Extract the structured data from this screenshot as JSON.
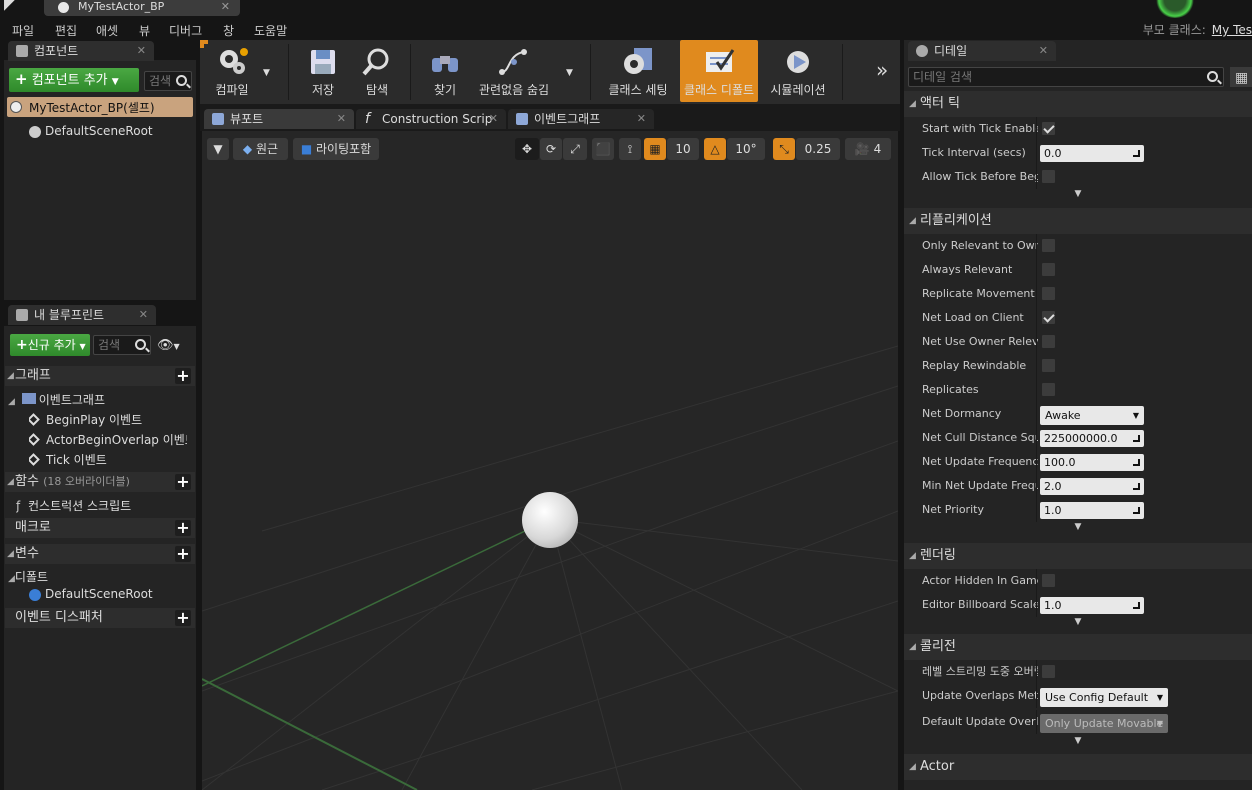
{
  "window": {
    "doc_tab_title": "MyTestActor_BP",
    "parent_class_label": "부모 클래스:",
    "parent_class_value": "My Tes"
  },
  "menu": [
    "파일",
    "편집",
    "애셋",
    "뷰",
    "디버그",
    "창",
    "도움말"
  ],
  "components_panel": {
    "tab_label": "컴포넌트",
    "add_button": "컴포넌트 추가",
    "search_placeholder": "검색",
    "root_item": "MyTestActor_BP(셀프)",
    "child_item": "DefaultSceneRoot"
  },
  "blueprint_panel": {
    "tab_label": "내 블루프린트",
    "add_new_button": "신규 추가",
    "search_placeholder": "검색",
    "sections": {
      "graphs": "그래프",
      "event_graph": "이벤트그래프",
      "events": [
        "BeginPlay 이벤트",
        "ActorBeginOverlap 이벤트",
        "Tick 이벤트"
      ],
      "functions": "함수",
      "functions_note": "(18 오버라이더블)",
      "construction_script": "컨스트럭션 스크립트",
      "macros": "매크로",
      "variables": "변수",
      "components": "디폴트",
      "components_item": "DefaultSceneRoot",
      "event_dispatchers": "이벤트 디스패처"
    }
  },
  "toolbar": {
    "compile": "컴파일",
    "save": "저장",
    "browse": "탐색",
    "find": "찾기",
    "hide_unrelated": "관련없음 숨김",
    "class_settings": "클래스 세팅",
    "class_defaults": "클래스 디폴트",
    "simulation": "시뮬레이션"
  },
  "editor_tabs": [
    "뷰포트",
    "Construction Scrip",
    "이벤트그래프"
  ],
  "viewport_toolbar": {
    "perspective": "원근",
    "lit": "라이팅포함",
    "grid_snap": "10",
    "rot_snap": "10°",
    "scale_snap": "0.25",
    "camera_speed": "4"
  },
  "details_panel": {
    "tab_label": "디테일",
    "search_placeholder": "디테일 검색",
    "sections": [
      {
        "title": "액터 틱",
        "props": [
          {
            "label": "Start with Tick Enabled",
            "type": "check",
            "value": true
          },
          {
            "label": "Tick Interval (secs)",
            "type": "num",
            "value": "0.0"
          },
          {
            "label": "Allow Tick Before Begin Play",
            "type": "check",
            "value": false
          }
        ]
      },
      {
        "title": "리플리케이션",
        "props": [
          {
            "label": "Only Relevant to Owner",
            "type": "check",
            "value": false
          },
          {
            "label": "Always Relevant",
            "type": "check",
            "value": false
          },
          {
            "label": "Replicate Movement",
            "type": "check",
            "value": false
          },
          {
            "label": "Net Load on Client",
            "type": "check",
            "value": true
          },
          {
            "label": "Net Use Owner Relevancy",
            "type": "check",
            "value": false
          },
          {
            "label": "Replay Rewindable",
            "type": "check",
            "value": false
          },
          {
            "label": "Replicates",
            "type": "check",
            "value": false
          },
          {
            "label": "Net Dormancy",
            "type": "combo",
            "value": "Awake"
          },
          {
            "label": "Net Cull Distance Squared",
            "type": "num",
            "value": "225000000.0"
          },
          {
            "label": "Net Update Frequency",
            "type": "num",
            "value": "100.0"
          },
          {
            "label": "Min Net Update Frequency",
            "type": "num",
            "value": "2.0"
          },
          {
            "label": "Net Priority",
            "type": "num",
            "value": "1.0"
          }
        ]
      },
      {
        "title": "렌더링",
        "props": [
          {
            "label": "Actor Hidden In Game",
            "type": "check",
            "value": false
          },
          {
            "label": "Editor Billboard Scale",
            "type": "num",
            "value": "1.0"
          }
        ]
      },
      {
        "title": "콜리전",
        "props": [
          {
            "label": "레벨 스트리밍 도중 오버랩 생성",
            "type": "check",
            "value": false
          },
          {
            "label": "Update Overlaps Method",
            "type": "combo",
            "value": "Use Config Default"
          },
          {
            "label": "Default Update Overlaps Method",
            "type": "combo",
            "value": "Only Update Movable",
            "disabled": true
          }
        ]
      },
      {
        "title": "Actor",
        "props": []
      }
    ]
  },
  "colors": {
    "accent_orange": "#e08a1e",
    "add_green": "#3d9a37",
    "panel_bg": "#242424",
    "viewport_bg": "#262626"
  }
}
